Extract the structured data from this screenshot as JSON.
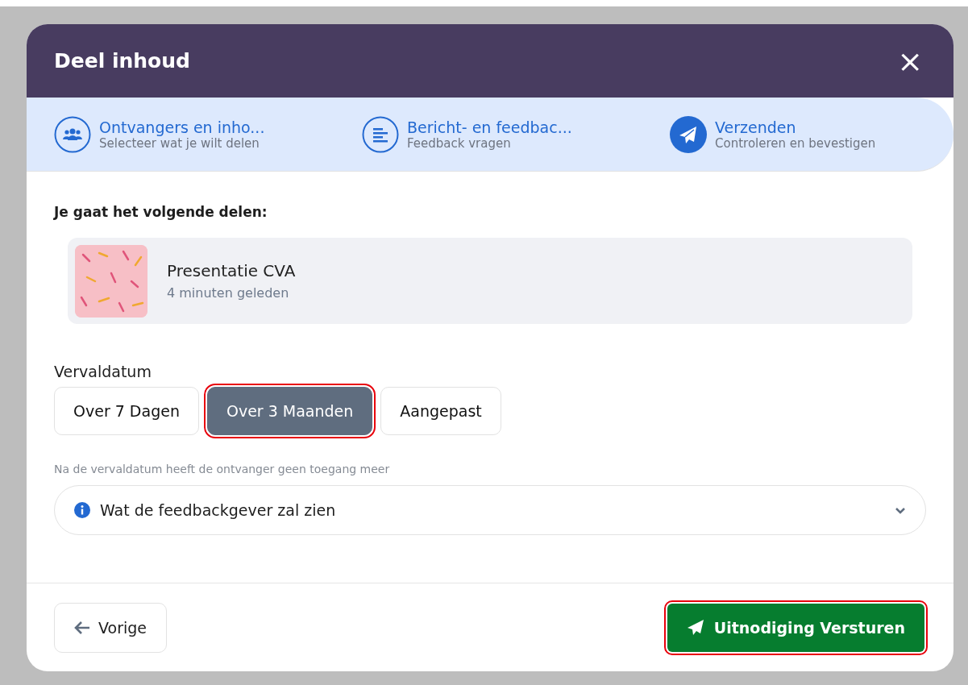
{
  "dialog": {
    "title": "Deel inhoud",
    "close": "×"
  },
  "steps": [
    {
      "title": "Ontvangers en inho...",
      "subtitle": "Selecteer wat je wilt delen",
      "kind": "people",
      "selected": false
    },
    {
      "title": "Bericht- en feedbac...",
      "subtitle": "Feedback vragen",
      "kind": "lines",
      "selected": false
    },
    {
      "title": "Verzenden",
      "subtitle": "Controleren en bevestigen",
      "kind": "send",
      "selected": true
    }
  ],
  "share_heading": "Je gaat het volgende delen:",
  "item": {
    "name": "Presentatie CVA",
    "time": "4 minuten geleden"
  },
  "expiry": {
    "label": "Vervaldatum",
    "options": [
      {
        "label": "Over 7 Dagen",
        "selected": false
      },
      {
        "label": "Over 3 Maanden",
        "selected": true
      },
      {
        "label": "Aangepast",
        "selected": false
      }
    ],
    "hint": "Na de vervaldatum heeft de ontvanger geen toegang meer"
  },
  "info_panel": {
    "label": "Wat de feedbackgever zal zien",
    "expanded": false
  },
  "footer": {
    "back": "Vorige",
    "send": "Uitnodiging Versturen",
    "send_highlighted": true
  }
}
